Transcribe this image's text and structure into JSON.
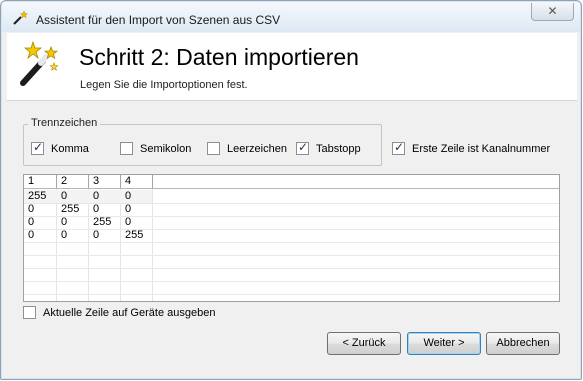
{
  "window": {
    "title": "Assistent für den Import von Szenen aus CSV",
    "close_glyph": "✕"
  },
  "header": {
    "title": "Schritt 2: Daten importieren",
    "subtitle": "Legen Sie die Importoptionen fest."
  },
  "delimiters": {
    "legend": "Trennzeichen",
    "options": [
      {
        "label": "Komma",
        "checked": true
      },
      {
        "label": "Semikolon",
        "checked": false
      },
      {
        "label": "Leerzeichen",
        "checked": false
      },
      {
        "label": "Tabstopp",
        "checked": true
      }
    ]
  },
  "first_row_channel": {
    "label": "Erste Zeile ist Kanalnummer",
    "checked": true
  },
  "table": {
    "columns": [
      "1",
      "2",
      "3",
      "4"
    ],
    "rows": [
      [
        "255",
        "0",
        "0",
        "0"
      ],
      [
        "0",
        "255",
        "0",
        "0"
      ],
      [
        "0",
        "0",
        "255",
        "0"
      ],
      [
        "0",
        "0",
        "0",
        "255"
      ]
    ]
  },
  "output_current_row": {
    "label": "Aktuelle Zeile auf Geräte ausgeben",
    "checked": false
  },
  "buttons": {
    "back": "< Zurück",
    "next": "Weiter >",
    "cancel": "Abbrechen"
  }
}
